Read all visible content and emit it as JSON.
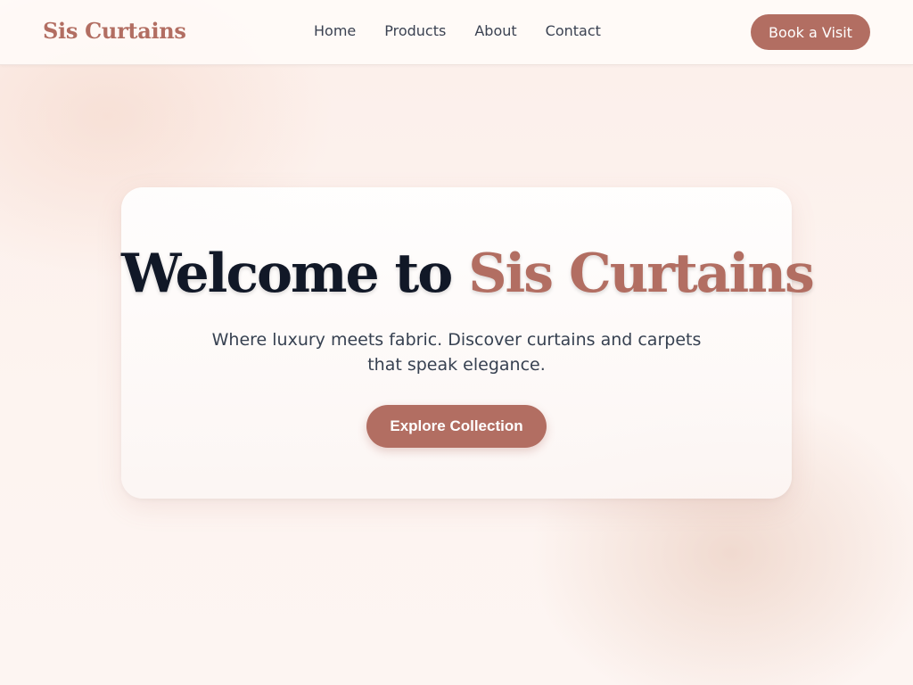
{
  "brand": {
    "name": "Sis Curtains",
    "accent_color": "#b26e62"
  },
  "nav": {
    "items": [
      {
        "label": "Home"
      },
      {
        "label": "Products"
      },
      {
        "label": "About"
      },
      {
        "label": "Contact"
      }
    ],
    "cta_label": "Book a Visit"
  },
  "hero": {
    "title_prefix": "Welcome to",
    "title_accent": "Sis Curtains",
    "subtitle": "Where luxury meets fabric. Discover curtains and carpets that speak elegance.",
    "button_label": "Explore Collection"
  }
}
